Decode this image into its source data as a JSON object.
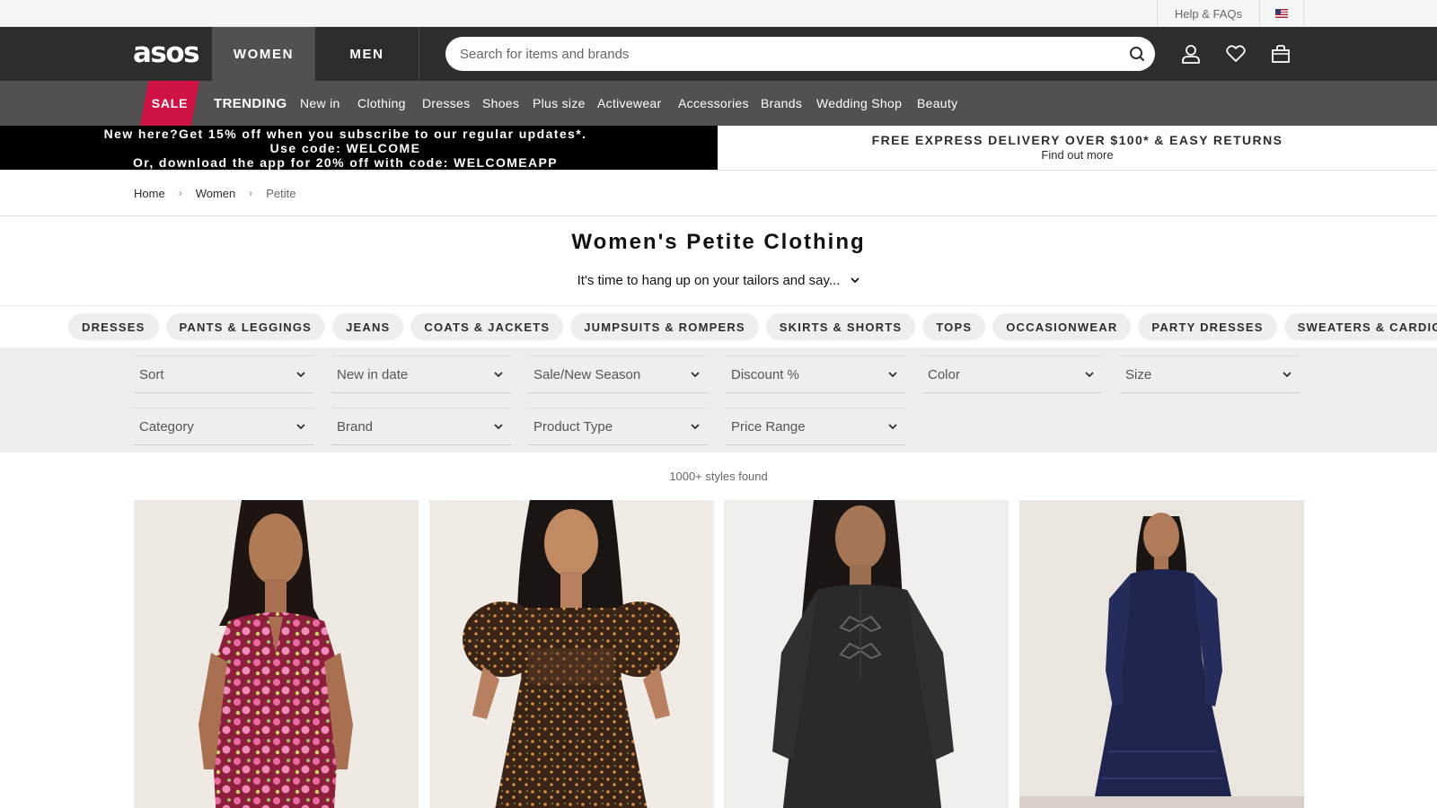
{
  "utility": {
    "help_label": "Help & FAQs",
    "country_flag": "us-flag"
  },
  "header": {
    "logo": "asos",
    "tabs": [
      {
        "label": "WOMEN",
        "active": true
      },
      {
        "label": "MEN",
        "active": false
      }
    ],
    "search": {
      "placeholder": "Search for items and brands",
      "value": ""
    },
    "icons": [
      "account-icon",
      "heart-icon",
      "bag-icon"
    ]
  },
  "nav": {
    "sale": "SALE",
    "items": [
      "TRENDING",
      "New in",
      "Clothing",
      "Dresses",
      "Shoes",
      "Plus size",
      "Activewear",
      "Accessories",
      "Brands",
      "Wedding Shop",
      "Beauty"
    ]
  },
  "promo": {
    "left_line1": "New here?Get 15% off when you subscribe to our regular updates*.",
    "left_line2": "Use code: WELCOME",
    "left_line3": "Or, download the app for 20% off with code: WELCOMEAPP",
    "right_title": "FREE EXPRESS DELIVERY OVER $100* & EASY RETURNS",
    "right_link": "Find out more"
  },
  "breadcrumb": [
    "Home",
    "Women",
    "Petite"
  ],
  "page": {
    "title": "Women's Petite Clothing",
    "intro": "It's time to hang up on your tailors and say..."
  },
  "pills": [
    "DRESSES",
    "PANTS & LEGGINGS",
    "JEANS",
    "COATS & JACKETS",
    "JUMPSUITS & ROMPERS",
    "SKIRTS & SHORTS",
    "TOPS",
    "OCCASIONWEAR",
    "PARTY DRESSES",
    "SWEATERS & CARDIGANS"
  ],
  "filters": {
    "row1": [
      "Sort",
      "New in date",
      "Sale/New Season",
      "Discount %",
      "Color",
      "Size"
    ],
    "row2": [
      "Category",
      "Brand",
      "Product Type",
      "Price Range"
    ]
  },
  "results": "1000+ styles found",
  "colors": {
    "header_bg": "#2d2d2d",
    "nav_bg": "#525050",
    "sale_red": "#d01345",
    "filter_bg": "#eeeeee"
  }
}
